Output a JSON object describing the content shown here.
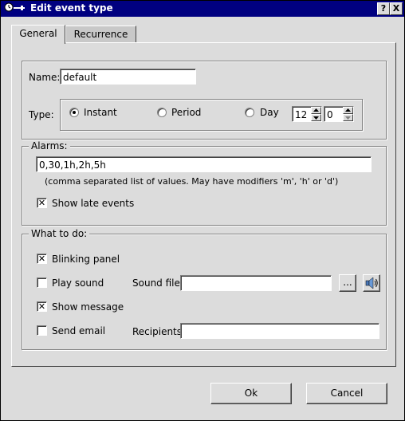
{
  "window": {
    "title": "Edit event type",
    "help_button": "?",
    "close_button": "X"
  },
  "tabs": [
    {
      "label": "General",
      "active": true
    },
    {
      "label": "Recurrence",
      "active": false
    }
  ],
  "general": {
    "name_label": "Name:",
    "name_value": "default",
    "type_label": "Type:",
    "type_options": [
      {
        "label": "Instant",
        "selected": true
      },
      {
        "label": "Period",
        "selected": false
      },
      {
        "label": "Day",
        "selected": false
      }
    ],
    "hour_value": "12",
    "minute_value": "0"
  },
  "alarms": {
    "legend": "Alarms:",
    "value": "0,30,1h,2h,5h",
    "hint": "(comma separated list of values. May have modifiers 'm', 'h' or 'd')",
    "show_late_label": "Show late events",
    "show_late_checked": true
  },
  "actions": {
    "legend": "What to do:",
    "blinking_label": "Blinking panel",
    "blinking_checked": true,
    "play_sound_label": "Play sound",
    "play_sound_checked": false,
    "sound_file_label": "Sound file:",
    "sound_file_value": "",
    "browse_label": "...",
    "show_message_label": "Show message",
    "show_message_checked": true,
    "send_email_label": "Send email",
    "send_email_checked": false,
    "recipients_label": "Recipients:",
    "recipients_value": ""
  },
  "footer": {
    "ok_label": "Ok",
    "cancel_label": "Cancel"
  }
}
